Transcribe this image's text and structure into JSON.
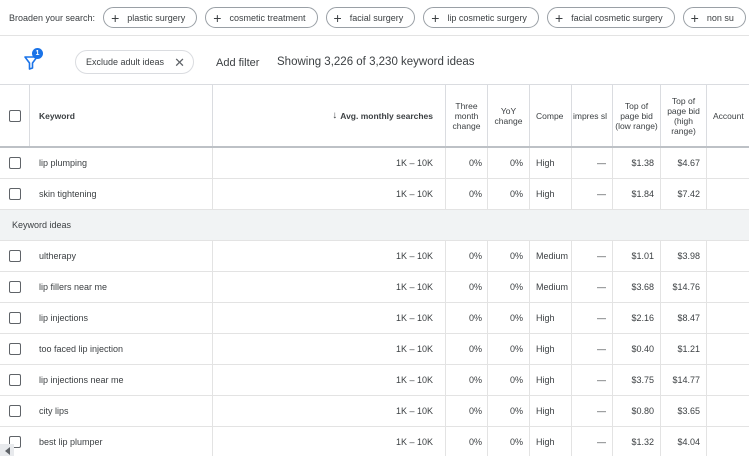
{
  "broaden": {
    "label": "Broaden your search:",
    "chips": [
      "plastic surgery",
      "cosmetic treatment",
      "facial surgery",
      "lip cosmetic surgery",
      "facial cosmetic surgery",
      "non su"
    ]
  },
  "filterbar": {
    "badge_count": "1",
    "exclude_chip": "Exclude adult ideas",
    "add_filter": "Add filter",
    "showing": "Showing 3,226 of 3,230 keyword ideas"
  },
  "table": {
    "headers": {
      "keyword": "Keyword",
      "avg": "Avg. monthly searches",
      "three_month": "Three month change",
      "yoy": "YoY change",
      "competition": "Compe",
      "impressions": "impres sl",
      "low_bid": "Top of page bid (low range)",
      "high_bid": "Top of page bid (high range)",
      "account": "Account"
    },
    "top_rows": [
      {
        "keyword": "lip plumping",
        "avg": "1K – 10K",
        "three": "0%",
        "yoy": "0%",
        "comp": "High",
        "imp": "—",
        "low": "$1.38",
        "high": "$4.67"
      },
      {
        "keyword": "skin tightening",
        "avg": "1K – 10K",
        "three": "0%",
        "yoy": "0%",
        "comp": "High",
        "imp": "—",
        "low": "$1.84",
        "high": "$7.42"
      }
    ],
    "section_label": "Keyword ideas",
    "idea_rows": [
      {
        "keyword": "ultherapy",
        "avg": "1K – 10K",
        "three": "0%",
        "yoy": "0%",
        "comp": "Medium",
        "imp": "—",
        "low": "$1.01",
        "high": "$3.98"
      },
      {
        "keyword": "lip fillers near me",
        "avg": "1K – 10K",
        "three": "0%",
        "yoy": "0%",
        "comp": "Medium",
        "imp": "—",
        "low": "$3.68",
        "high": "$14.76"
      },
      {
        "keyword": "lip injections",
        "avg": "1K – 10K",
        "three": "0%",
        "yoy": "0%",
        "comp": "High",
        "imp": "—",
        "low": "$2.16",
        "high": "$8.47"
      },
      {
        "keyword": "too faced lip injection",
        "avg": "1K – 10K",
        "three": "0%",
        "yoy": "0%",
        "comp": "High",
        "imp": "—",
        "low": "$0.40",
        "high": "$1.21"
      },
      {
        "keyword": "lip injections near me",
        "avg": "1K – 10K",
        "three": "0%",
        "yoy": "0%",
        "comp": "High",
        "imp": "—",
        "low": "$3.75",
        "high": "$14.77"
      },
      {
        "keyword": "city lips",
        "avg": "1K – 10K",
        "three": "0%",
        "yoy": "0%",
        "comp": "High",
        "imp": "—",
        "low": "$0.80",
        "high": "$3.65"
      },
      {
        "keyword": "best lip plumper",
        "avg": "1K – 10K",
        "three": "0%",
        "yoy": "0%",
        "comp": "High",
        "imp": "—",
        "low": "$1.32",
        "high": "$4.04"
      }
    ]
  },
  "colors": {
    "accent": "#1a73e8",
    "section_bg": "#f1f3f4",
    "text": "#3c4043"
  }
}
